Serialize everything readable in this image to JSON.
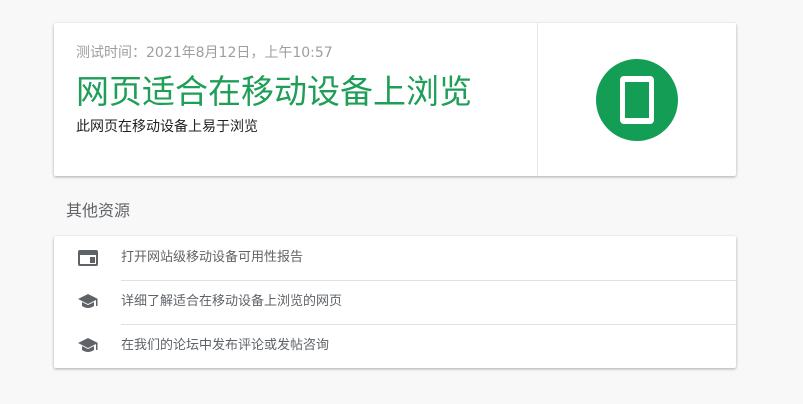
{
  "result": {
    "test_time": "测试时间：2021年8月12日，上午10:57",
    "title": "网页适合在移动设备上浏览",
    "subtitle": "此网页在移动设备上易于浏览",
    "status_icon": "mobile-phone-icon",
    "accent_color": "#1e9e57"
  },
  "resources": {
    "title": "其他资源",
    "items": [
      {
        "icon": "web-page-icon",
        "label": "打开网站级移动设备可用性报告"
      },
      {
        "icon": "graduation-cap-icon",
        "label": "详细了解适合在移动设备上浏览的网页"
      },
      {
        "icon": "graduation-cap-icon",
        "label": "在我们的论坛中发布评论或发帖咨询"
      }
    ]
  }
}
